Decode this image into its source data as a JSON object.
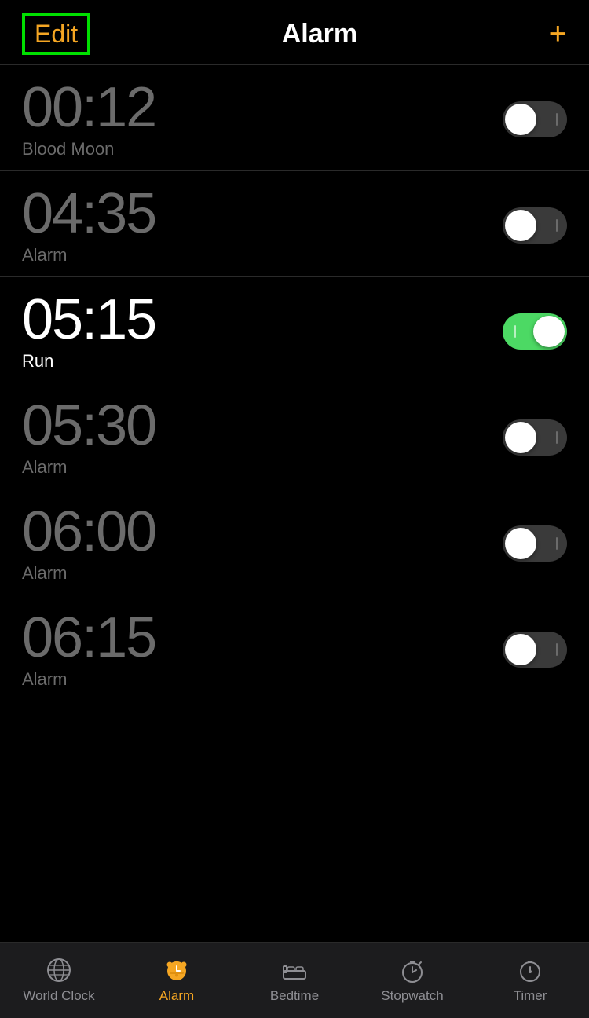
{
  "header": {
    "edit_label": "Edit",
    "title": "Alarm",
    "add_label": "+"
  },
  "alarms": [
    {
      "time": "00:12",
      "label": "Blood Moon",
      "active": false
    },
    {
      "time": "04:35",
      "label": "Alarm",
      "active": false
    },
    {
      "time": "05:15",
      "label": "Run",
      "active": true
    },
    {
      "time": "05:30",
      "label": "Alarm",
      "active": false
    },
    {
      "time": "06:00",
      "label": "Alarm",
      "active": false
    },
    {
      "time": "06:15",
      "label": "Alarm",
      "active": false
    }
  ],
  "tabs": [
    {
      "id": "world-clock",
      "label": "World Clock",
      "active": false
    },
    {
      "id": "alarm",
      "label": "Alarm",
      "active": true
    },
    {
      "id": "bedtime",
      "label": "Bedtime",
      "active": false
    },
    {
      "id": "stopwatch",
      "label": "Stopwatch",
      "active": false
    },
    {
      "id": "timer",
      "label": "Timer",
      "active": false
    }
  ]
}
